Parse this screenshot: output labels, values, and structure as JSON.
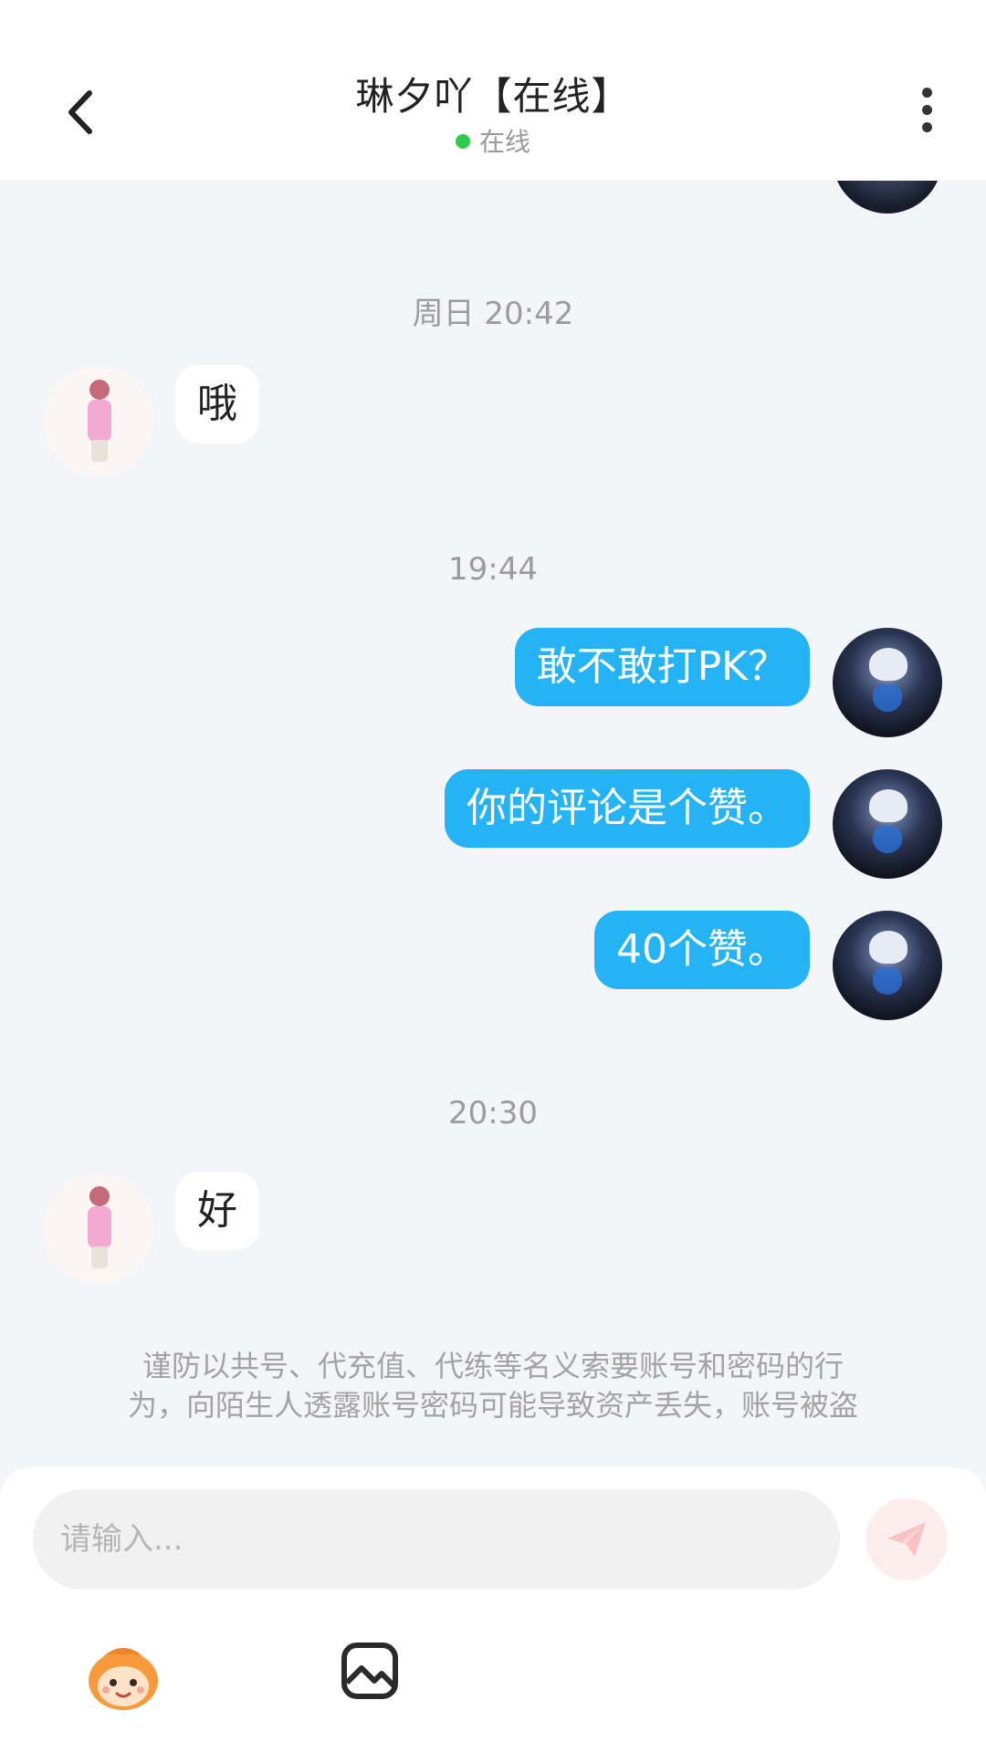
{
  "header": {
    "title": "琳夕吖【在线】",
    "status": "在线"
  },
  "messages": {
    "ts1": "周日 20:42",
    "m1": "哦",
    "ts2": "19:44",
    "m2": "敢不敢打PK？",
    "m3": "你的评论是个赞。",
    "m4": "40个赞。",
    "ts3": "20:30",
    "m5": "好"
  },
  "notice": {
    "line1": "谨防以共号、代充值、代练等名义索要账号和密码的行",
    "line2": "为，向陌生人透露账号密码可能导致资产丢失，账号被盗"
  },
  "composer": {
    "placeholder": "请输入..."
  },
  "colors": {
    "accent": "#24b3f4",
    "online": "#2ecb4a",
    "background": "#f3f5f8"
  },
  "icons": [
    "back-icon",
    "more-icon",
    "send-icon",
    "emoji-icon",
    "image-icon"
  ]
}
